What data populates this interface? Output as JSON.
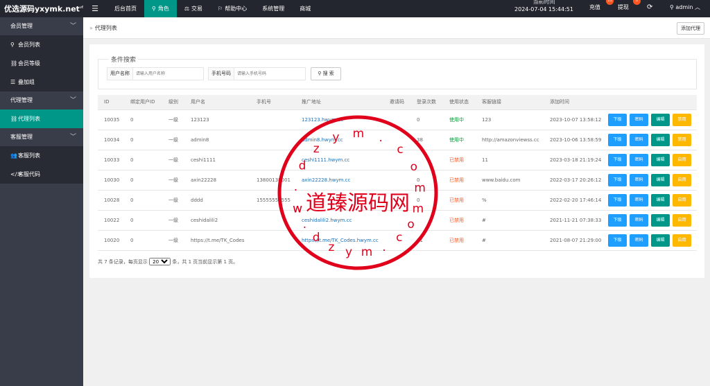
{
  "brand": {
    "name": "优选源码yxymk.net",
    "sup": "v6"
  },
  "topnav": {
    "items": [
      {
        "label": "后台首页",
        "icon": ""
      },
      {
        "label": "角色",
        "icon": "user-icon",
        "active": true
      },
      {
        "label": "交易",
        "icon": "scale-icon"
      },
      {
        "label": "帮助中心",
        "icon": "flag-icon"
      },
      {
        "label": "系统管理",
        "icon": ""
      },
      {
        "label": "商城",
        "icon": ""
      }
    ],
    "time_label": "当前时间",
    "time_value": "2024-07-04 15:44:51",
    "recharge": {
      "label": "充值",
      "badge": "25"
    },
    "withdraw": {
      "label": "提现",
      "badge": "0"
    },
    "user": "admin"
  },
  "sidebar": {
    "groups": [
      {
        "label": "会员管理",
        "items": [
          {
            "label": "会员列表",
            "icon": "user-icon"
          },
          {
            "label": "会员等级",
            "icon": "link-icon"
          },
          {
            "label": "叠加组",
            "icon": "list-icon"
          }
        ]
      },
      {
        "label": "代理管理",
        "items": [
          {
            "label": "代理列表",
            "icon": "link-icon",
            "active": true
          }
        ]
      },
      {
        "label": "客服管理",
        "items": [
          {
            "label": "客服列表",
            "icon": "users-icon"
          },
          {
            "label": "客服代码",
            "icon": "code-icon"
          }
        ]
      }
    ]
  },
  "breadcrumb": {
    "sep": "»",
    "label": "代理列表"
  },
  "add_button": "添加代理",
  "search": {
    "legend": "条件搜索",
    "username_label": "用户名称",
    "username_placeholder": "请输入用户名称",
    "phone_label": "手机号码",
    "phone_placeholder": "请输入手机号码",
    "button": "搜 索"
  },
  "table": {
    "headers": [
      "ID",
      "绑定用户ID",
      "级别",
      "用户名",
      "手机号",
      "推广地址",
      "邀请码",
      "登录次数",
      "使用状态",
      "客服链接",
      "添加时间",
      ""
    ],
    "rows": [
      {
        "id": "10035",
        "bind": "0",
        "level": "一级",
        "username": "123123",
        "phone": "",
        "url": "123123.hwym.cc",
        "invite": "",
        "logins": "0",
        "status": "使用中",
        "status_on": true,
        "service": "123",
        "time": "2023-10-07 13:58:12",
        "toggle": "禁用"
      },
      {
        "id": "10034",
        "bind": "0",
        "level": "一级",
        "username": "admin8",
        "phone": "",
        "url": "admin8.hwym.cc",
        "invite": "",
        "logins": "38",
        "status": "使用中",
        "status_on": true,
        "service": "http://amazonviewss.cc",
        "time": "2023-10-06 13:58:59",
        "toggle": "禁用"
      },
      {
        "id": "10033",
        "bind": "0",
        "level": "一级",
        "username": "ceshi1111",
        "phone": "",
        "url": "ceshi1111.hwym.cc",
        "invite": "",
        "logins": "",
        "status": "已禁用",
        "status_on": false,
        "service": "11",
        "time": "2023-03-18 21:19:24",
        "toggle": "启用"
      },
      {
        "id": "10030",
        "bind": "0",
        "level": "一级",
        "username": "axin22228",
        "phone": "13800138001",
        "url": "axin22228.hwym.cc",
        "invite": "",
        "logins": "0",
        "status": "已禁用",
        "status_on": false,
        "service": "www.baidu.com",
        "time": "2022-03-17 20:26:12",
        "toggle": "启用"
      },
      {
        "id": "10028",
        "bind": "0",
        "level": "一级",
        "username": "dddd",
        "phone": "15555555555",
        "url": "",
        "invite": "",
        "logins": "0",
        "status": "已禁用",
        "status_on": false,
        "service": "%",
        "time": "2022-02-20 17:46:14",
        "toggle": "启用"
      },
      {
        "id": "10022",
        "bind": "0",
        "level": "一级",
        "username": "ceshidalili2",
        "phone": "",
        "url": "ceshidalili2.hwym.cc",
        "invite": "",
        "logins": "",
        "status": "已禁用",
        "status_on": false,
        "service": "#",
        "time": "2021-11-21 07:38:33",
        "toggle": "启用"
      },
      {
        "id": "10020",
        "bind": "0",
        "level": "一级",
        "username": "https://t.me/TK_Codes",
        "phone": "",
        "url": "https://t.me/TK_Codes.hwym.cc",
        "invite": "",
        "logins": "11",
        "status": "已禁用",
        "status_on": false,
        "service": "#",
        "time": "2021-08-07 21:29:00",
        "toggle": "启用"
      }
    ],
    "op_down": "下级",
    "op_pwd": "密码",
    "op_edit": "编辑"
  },
  "pager": {
    "prefix": "共 7 条记录，每页显示",
    "per_page": "20",
    "suffix": "条，共 1 页当前显示第 1 页。"
  },
  "stamp": {
    "title": "道臻源码网",
    "ring": "w.dzym.com",
    "color": "#e0001b"
  }
}
